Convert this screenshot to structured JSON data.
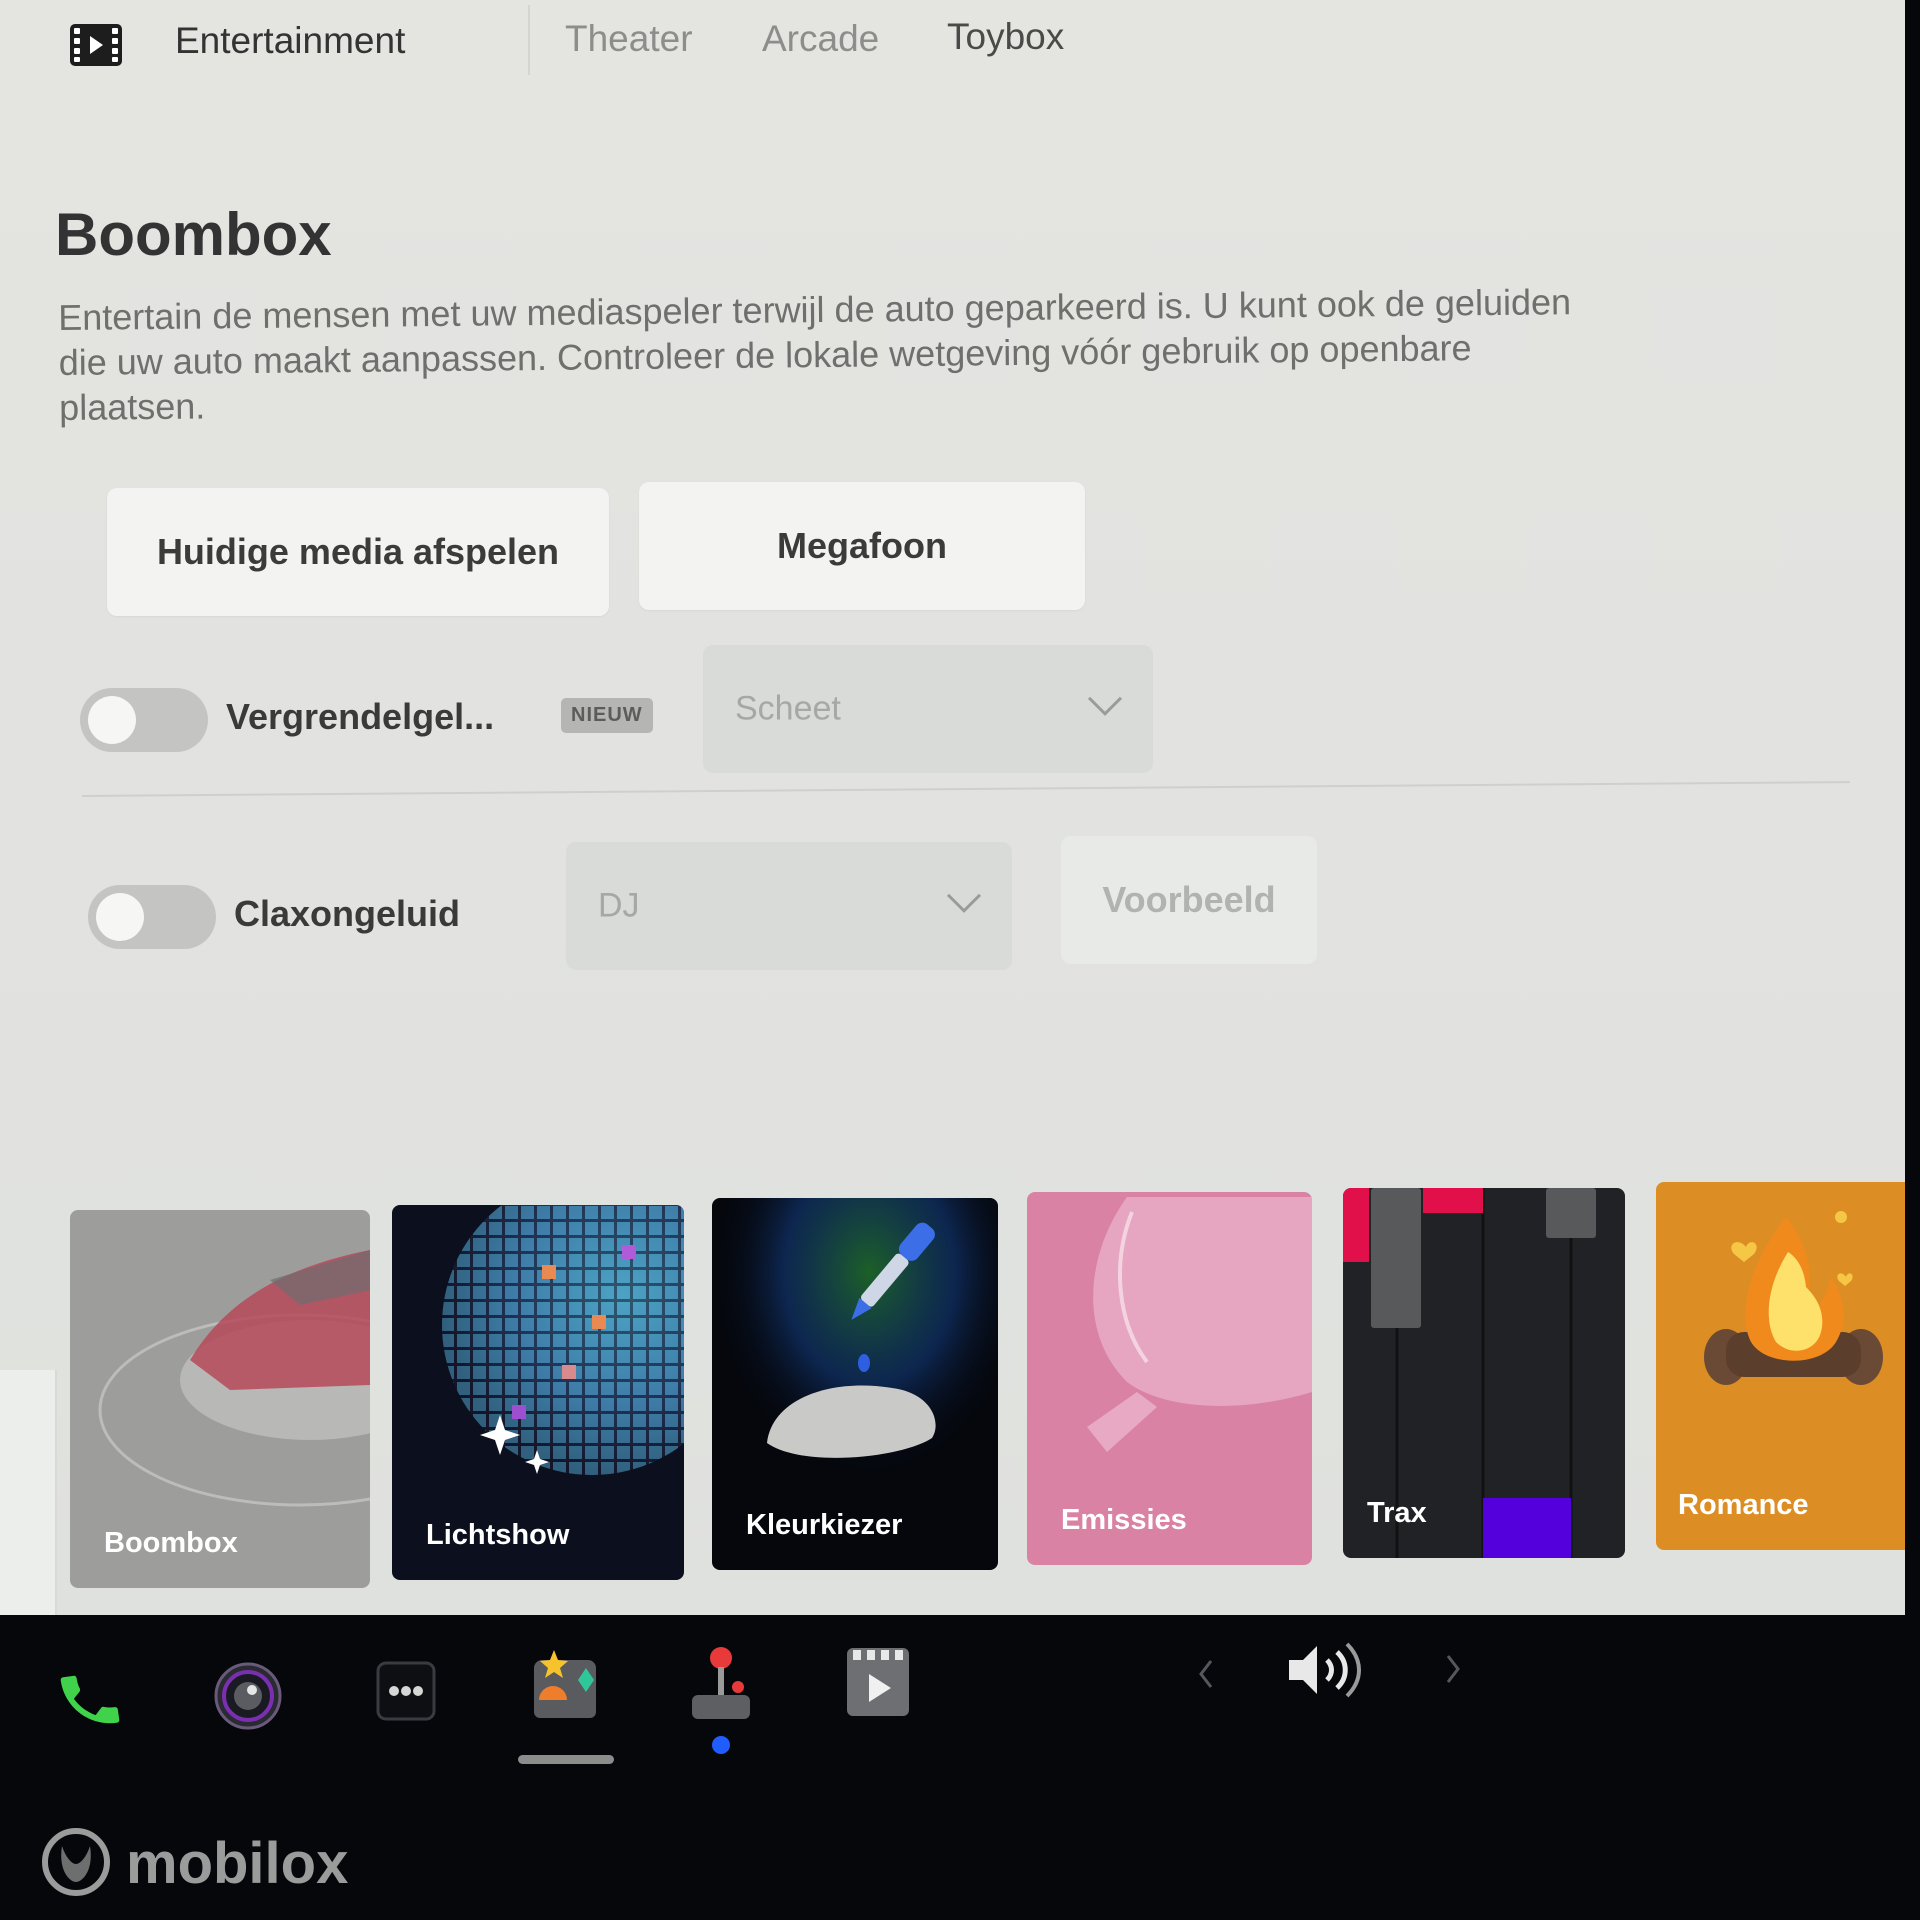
{
  "nav": {
    "title": "Entertainment",
    "icon": "film-icon",
    "tabs": [
      {
        "label": "Theater",
        "active": false
      },
      {
        "label": "Arcade",
        "active": false
      },
      {
        "label": "Toybox",
        "active": true
      }
    ]
  },
  "page": {
    "title": "Boombox",
    "description": "Entertain de mensen met uw mediaspeler terwijl de auto geparkeerd is. U kunt ook de geluiden die uw auto maakt aanpassen. Controleer de lokale wetgeving vóór gebruik op openbare plaatsen."
  },
  "buttons": {
    "play_media": "Huidige media afspelen",
    "megaphone": "Megafoon"
  },
  "lock_sound": {
    "label": "Vergrendelgel...",
    "enabled": false,
    "badge": "NIEUW",
    "selected": "Scheet"
  },
  "horn_sound": {
    "label": "Claxongeluid",
    "enabled": false,
    "selected": "DJ",
    "preview_label": "Voorbeeld"
  },
  "apps": [
    {
      "label": "Boombox",
      "color": "#9a9b99"
    },
    {
      "label": "Lichtshow",
      "color": "#0c0f1d"
    },
    {
      "label": "Kleurkiezer",
      "color": "#05070d"
    },
    {
      "label": "Emissies",
      "color": "#d982a4"
    },
    {
      "label": "Trax",
      "color": "#212226"
    },
    {
      "label": "Romance",
      "color": "#dc8e25"
    }
  ],
  "dock": {
    "items": [
      "phone-icon",
      "camera-icon",
      "more-icon",
      "toybox-icon",
      "arcade-joystick-icon",
      "theater-icon"
    ],
    "active": "toybox-icon",
    "volume_icon": "volume-icon"
  },
  "watermark": "mobilox"
}
